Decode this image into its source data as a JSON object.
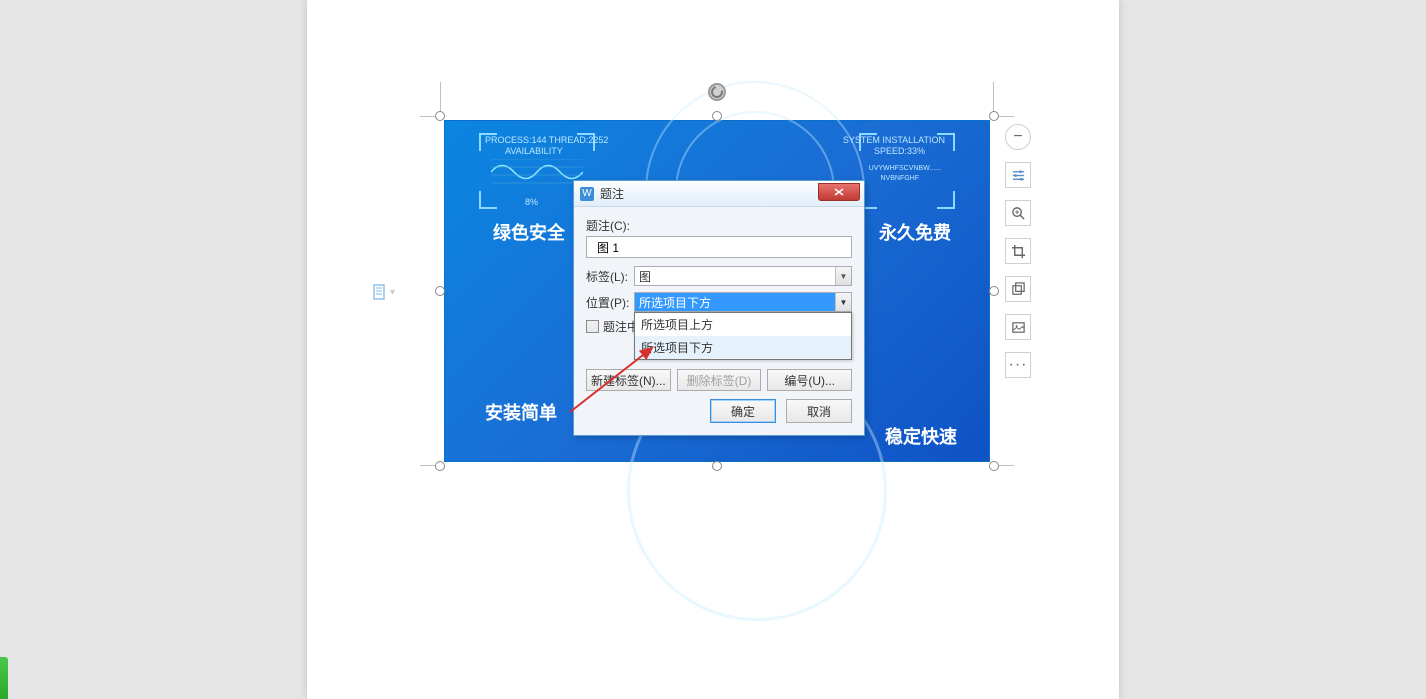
{
  "image_content": {
    "header_left_line1": "PROCESS:144 THREAD:2252",
    "header_left_line2": "AVAILABILITY",
    "header_left_pct": "8%",
    "header_right_line1": "SYSTEM INSTALLATION",
    "header_right_line2": "SPEED:33%",
    "header_right_sub1": "UVYWHFSCVNBW......",
    "header_right_sub2": "NVBNFGHF",
    "label_green_safe": "绿色安全",
    "label_free": "永久免费",
    "label_simple_install": "安装简单",
    "label_stable_fast": "稳定快速"
  },
  "dialog": {
    "title": "题注",
    "caption_label": "题注(C):",
    "caption_value": "图 1",
    "label_label": "标签(L):",
    "label_value": "图",
    "position_label": "位置(P):",
    "position_value": "所选项目下方",
    "dropdown_options": [
      "所选项目上方",
      "所选项目下方"
    ],
    "checkbox_label": "题注中",
    "new_label_btn": "新建标签(N)...",
    "delete_label_btn": "删除标签(D)",
    "numbering_btn": "编号(U)...",
    "ok_btn": "确定",
    "cancel_btn": "取消"
  },
  "toolbar": {
    "minus": "−",
    "more": "···"
  }
}
